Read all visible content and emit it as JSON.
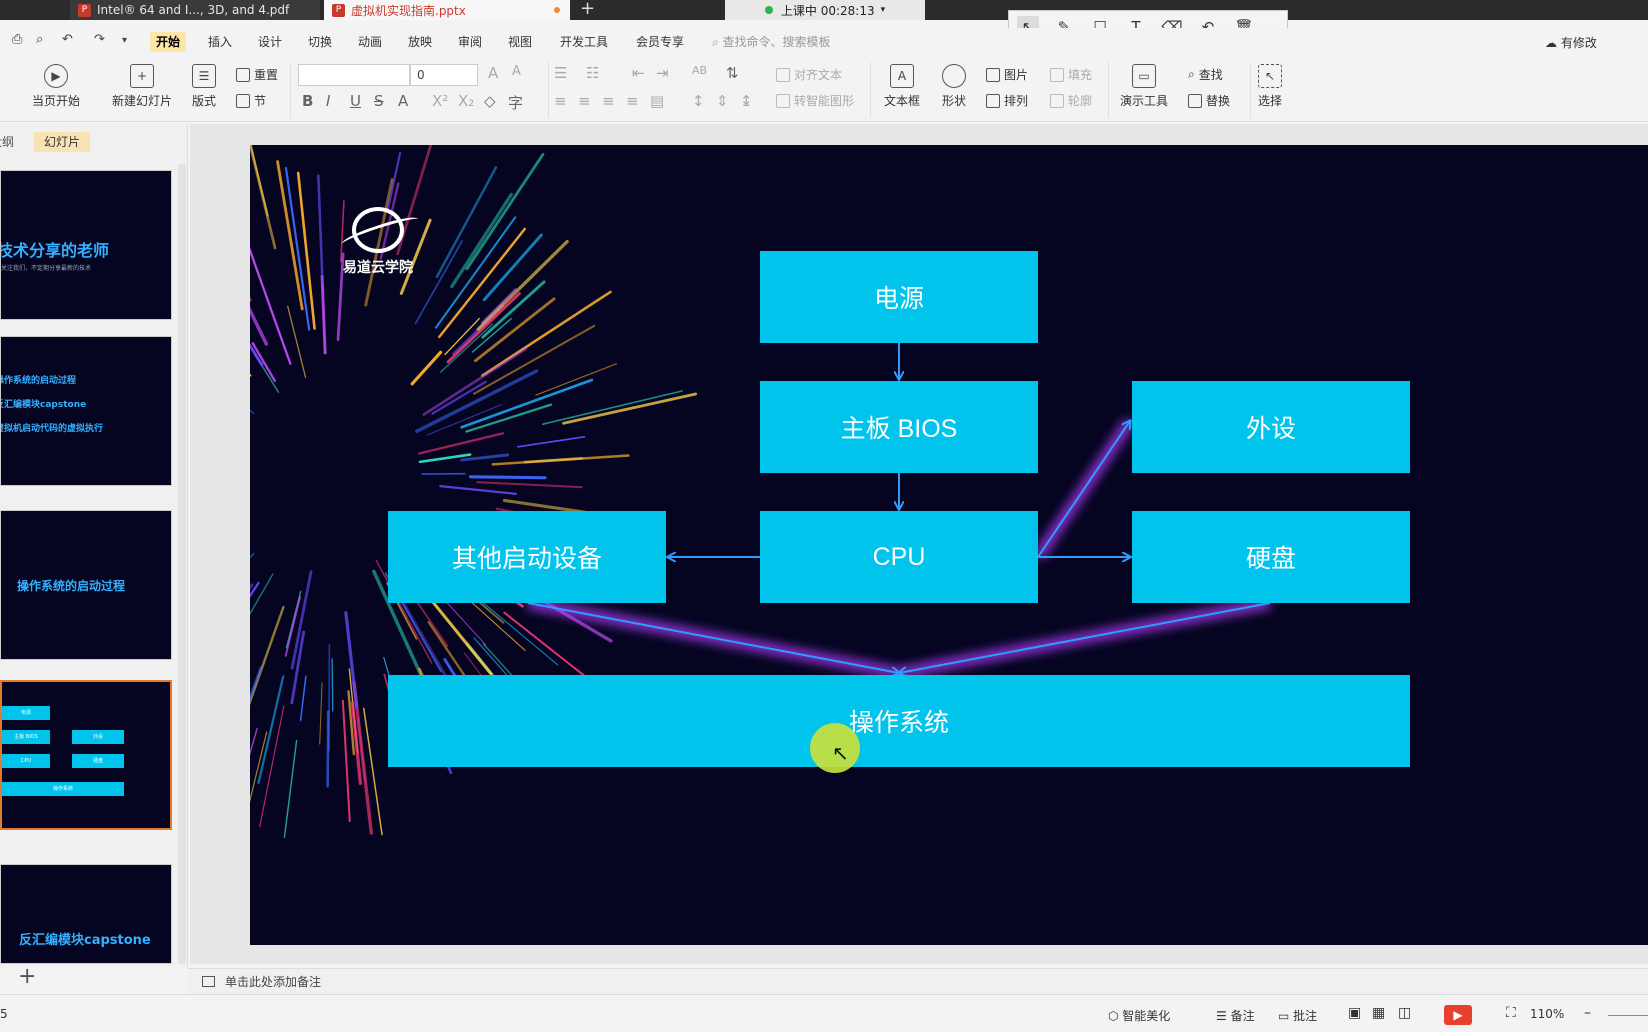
{
  "tabs": [
    {
      "label": "Intel® 64 and I..., 3D, and 4.pdf"
    },
    {
      "label": "虚拟机实现指南.pptx"
    }
  ],
  "recording": {
    "label": "上课中 00:28:13"
  },
  "menu": [
    "开始",
    "插入",
    "设计",
    "切换",
    "动画",
    "放映",
    "审阅",
    "视图",
    "开发工具",
    "会员专享"
  ],
  "search_placeholder": "查找命令、搜索模板",
  "cloud_label": "有修改",
  "ribbon": {
    "from_current": "当页开始",
    "new_slide": "新建幻灯片",
    "layout": "版式",
    "reset": "重置",
    "section": "节",
    "font_size": "0",
    "align_text": "对齐文本",
    "smart_art": "转智能图形",
    "textbox": "文本框",
    "shape": "形状",
    "picture": "图片",
    "arrange": "排列",
    "fill": "填充",
    "outline": "轮廓",
    "presenter": "演示工具",
    "find": "查找",
    "replace": "替换",
    "select": "选择"
  },
  "panel_tabs": [
    "大纲",
    "幻灯片"
  ],
  "thumbnails": {
    "t1_title": "技术分享的老师",
    "t1_sub": "关注我们，不定期分享最新的技术",
    "t2_items": [
      "操作系统的启动过程",
      "反汇编模块capstone",
      "虚拟机启动代码的虚拟执行"
    ],
    "t3_title": "操作系统的启动过程",
    "t4_boxes": [
      "电源",
      "主板 BIOS",
      "外设",
      "CPU",
      "硬盘",
      "操作系统"
    ],
    "t5_title": "反汇编模块capstone"
  },
  "slide": {
    "logo_text": "易道云学院",
    "boxes": {
      "power": "电源",
      "bios": "主板  BIOS",
      "peripheral": "外设",
      "other_boot": "其他启动设备",
      "cpu": "CPU",
      "disk": "硬盘",
      "os": "操作系统"
    },
    "box_color": "#00c4ec",
    "arrow_color": "#2f9cff",
    "glow_color": "#b23cff",
    "background": "#050521"
  },
  "notes_placeholder": "单击此处添加备注",
  "status": {
    "slide_index": "5",
    "beautify": "智能美化",
    "notes": "备注",
    "comment": "批注",
    "zoom": "110%"
  }
}
